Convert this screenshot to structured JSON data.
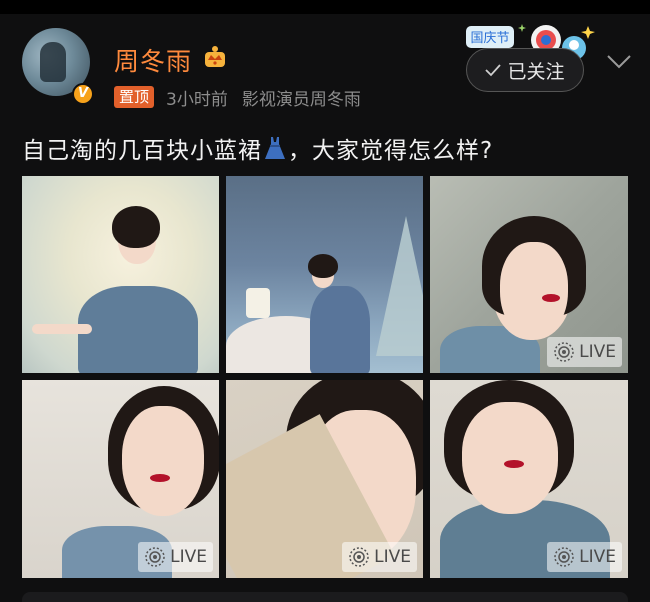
{
  "post": {
    "username": "周冬雨",
    "pin_label": "置顶",
    "time": "3小时前",
    "source": "影视演员周冬雨",
    "follow_label": "已关注",
    "festival_badge_text": "国庆节",
    "text_before_emoji": "自己淘的几百块小蓝裙",
    "text_after_emoji": "，大家觉得怎么样?",
    "username_color": "#ff8a3d",
    "pin_color": "#e2602b"
  },
  "photos": [
    {
      "live": false
    },
    {
      "live": false
    },
    {
      "live": true,
      "badge": "LIVE"
    },
    {
      "live": true,
      "badge": "LIVE"
    },
    {
      "live": true,
      "badge": "LIVE"
    },
    {
      "live": true,
      "badge": "LIVE"
    }
  ],
  "icons": {
    "verified": "v-verified-icon",
    "crown": "crown-icon",
    "check": "check-icon",
    "chevron": "chevron-down-icon",
    "live": "live-photo-icon",
    "dress": "dress-emoji"
  }
}
